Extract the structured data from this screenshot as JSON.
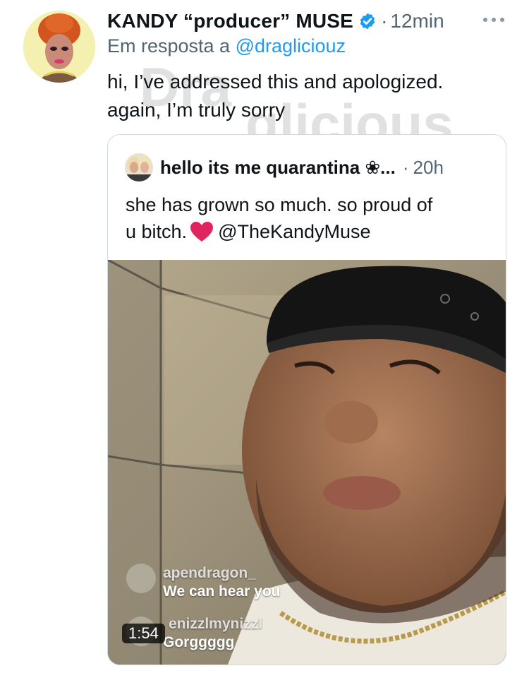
{
  "tweet": {
    "display_name": "KANDY “producer” MUSE",
    "verified_icon": "verified-badge-icon",
    "separator": "·",
    "time": "12min",
    "more_icon": "more-horizontal-icon",
    "reply_prefix": "Em resposta a",
    "reply_to": "@dragliciouz",
    "text_line1": "hi, I’ve addressed this and apologized.",
    "text_line2": "again, I’m truly sorry",
    "watermark": "Draglicious"
  },
  "quote": {
    "display_name": "hello its me quarantina ❀...",
    "separator": "·",
    "time": "20h",
    "text_line1": "she has grown so much. so proud of",
    "text_line2_start": "u bitch.",
    "heart_icon": "red-heart-icon",
    "mention": "@TheKandyMuse",
    "video": {
      "duration": "1:54",
      "comments": [
        {
          "user": "apendragon_",
          "text": "We can hear you"
        },
        {
          "user": "enizzlmynizzl",
          "text": "Gorggggg"
        }
      ]
    }
  },
  "colors": {
    "text_primary": "#0f1419",
    "text_secondary": "#536471",
    "link": "#1d9bf0",
    "border": "#cfd9de",
    "heart": "#e0245e"
  }
}
